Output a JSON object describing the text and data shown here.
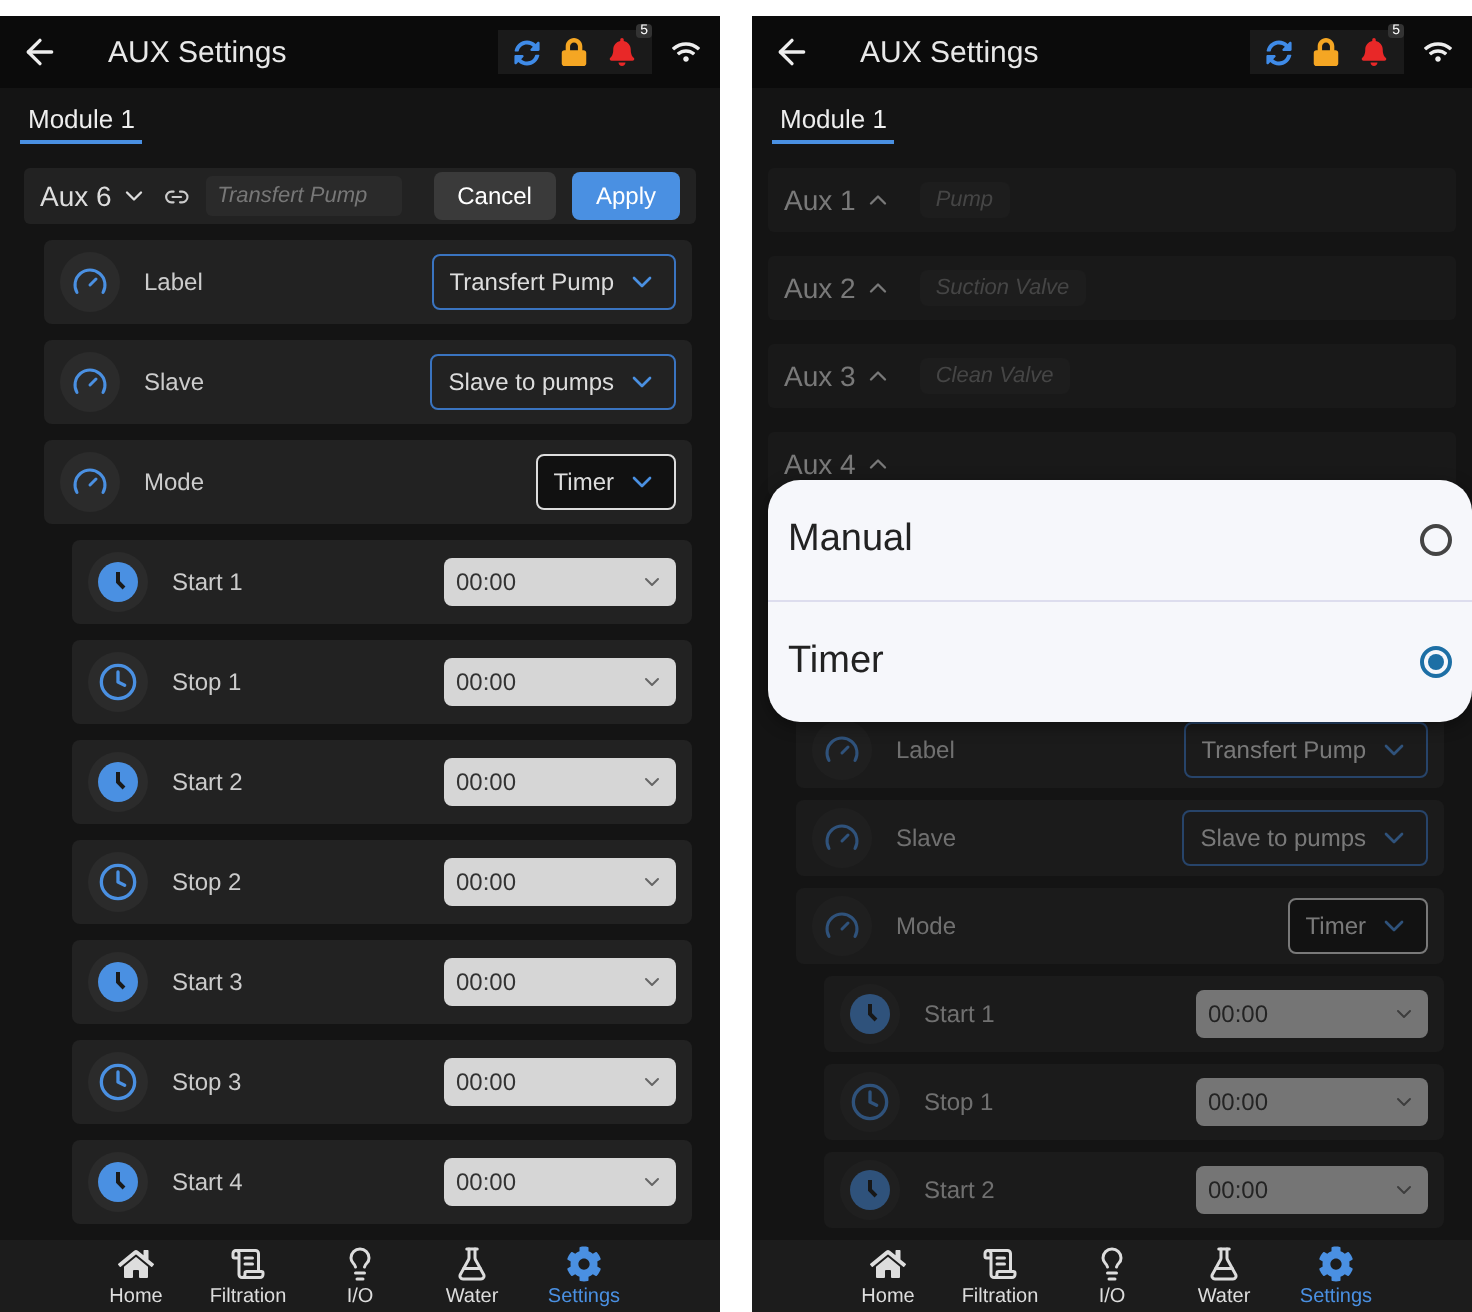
{
  "screens": [
    {
      "title": "AUX Settings",
      "alert_count": "5",
      "dimmed": false,
      "tabs": [
        {
          "label": "Module 1",
          "selected": true
        }
      ],
      "editor": {
        "aux": "Aux 6",
        "placeholder": "Transfert Pump",
        "buttons": [
          {
            "label": "Cancel",
            "kind": "secondary"
          },
          {
            "label": "Apply",
            "kind": "primary"
          }
        ]
      },
      "settings": [
        {
          "label": "Label",
          "value": "Transfert Pump",
          "focused": false
        },
        {
          "label": "Slave",
          "value": "Slave to pumps",
          "focused": false
        },
        {
          "label": "Mode",
          "value": "Timer",
          "focused": true
        }
      ],
      "schedule": [
        {
          "label": "Start 1",
          "value": "00:00",
          "kind": "start"
        },
        {
          "label": "Stop 1",
          "value": "00:00",
          "kind": "stop"
        },
        {
          "label": "Start 2",
          "value": "00:00",
          "kind": "start"
        },
        {
          "label": "Stop 2",
          "value": "00:00",
          "kind": "stop"
        },
        {
          "label": "Start 3",
          "value": "00:00",
          "kind": "start"
        },
        {
          "label": "Stop 3",
          "value": "00:00",
          "kind": "stop"
        },
        {
          "label": "Start 4",
          "value": "00:00",
          "kind": "start"
        }
      ],
      "nav": [
        {
          "label": "Home",
          "kind": "home",
          "selected": false
        },
        {
          "label": "Filtration",
          "kind": "filtration",
          "selected": false
        },
        {
          "label": "I/O",
          "kind": "io",
          "selected": false
        },
        {
          "label": "Water",
          "kind": "water",
          "selected": false
        },
        {
          "label": "Settings",
          "kind": "settings",
          "selected": true
        }
      ]
    },
    {
      "title": "AUX Settings",
      "alert_count": "5",
      "dimmed": true,
      "tabs": [
        {
          "label": "Module 1",
          "selected": true
        }
      ],
      "aux_list": [
        {
          "name": "Aux 1",
          "label": "Pump"
        },
        {
          "name": "Aux 2",
          "label": "Suction Valve"
        },
        {
          "name": "Aux 3",
          "label": "Clean Valve"
        },
        {
          "name": "Aux 4"
        }
      ],
      "settings": [
        {
          "label": "Label",
          "value": "Transfert Pump",
          "focused": false
        },
        {
          "label": "Slave",
          "value": "Slave to pumps",
          "focused": false
        },
        {
          "label": "Mode",
          "value": "Timer",
          "focused": true
        }
      ],
      "schedule": [
        {
          "label": "Start 1",
          "value": "00:00",
          "kind": "start"
        },
        {
          "label": "Stop 1",
          "value": "00:00",
          "kind": "stop"
        },
        {
          "label": "Start 2",
          "value": "00:00",
          "kind": "start"
        }
      ],
      "dialog": {
        "options": [
          {
            "label": "Manual",
            "selected": false
          },
          {
            "label": "Timer",
            "selected": true
          }
        ]
      },
      "nav": [
        {
          "label": "Home",
          "kind": "home",
          "selected": false
        },
        {
          "label": "Filtration",
          "kind": "filtration",
          "selected": false
        },
        {
          "label": "I/O",
          "kind": "io",
          "selected": false
        },
        {
          "label": "Water",
          "kind": "water",
          "selected": false
        },
        {
          "label": "Settings",
          "kind": "settings",
          "selected": true
        }
      ]
    }
  ]
}
